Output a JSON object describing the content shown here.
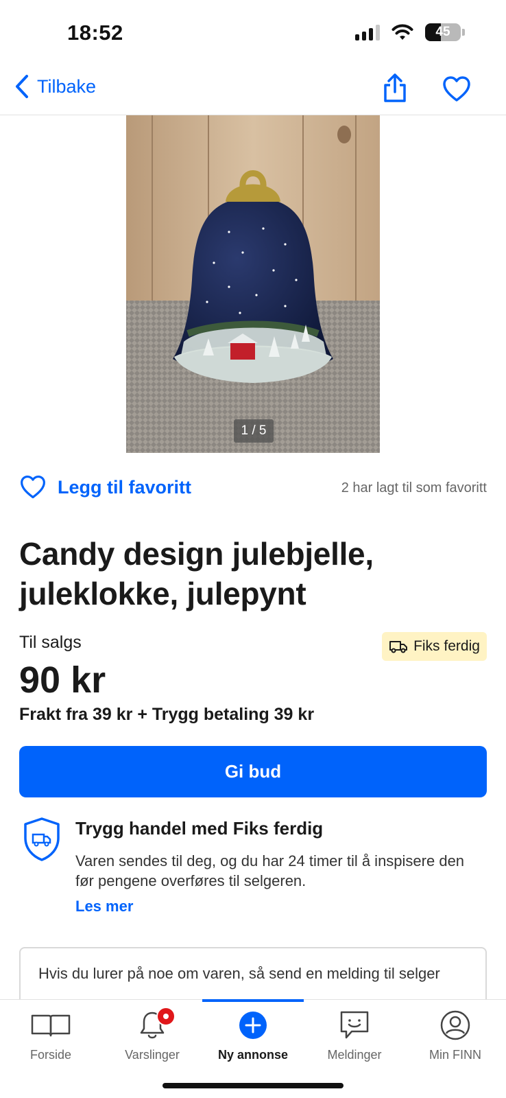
{
  "status_bar": {
    "time": "18:52",
    "battery": "45"
  },
  "nav": {
    "back_label": "Tilbake"
  },
  "gallery": {
    "counter": "1 / 5"
  },
  "favorite": {
    "add_label": "Legg til favoritt",
    "count_text": "2 har lagt til som favoritt"
  },
  "listing": {
    "title": "Candy design julebjelle, juleklokke, julepynt",
    "status": "Til salgs",
    "badge": "Fiks ferdig",
    "price": "90 kr",
    "shipping": "Frakt fra 39 kr + Trygg betaling 39 kr"
  },
  "actions": {
    "bid_label": "Gi bud"
  },
  "safe_trade": {
    "title": "Trygg handel med Fiks ferdig",
    "text": "Varen sendes til deg, og du har 24 timer til å inspisere den før pengene overføres til selgeren.",
    "link": "Les mer"
  },
  "message": {
    "prompt": "Hvis du lurer på noe om varen, så send en melding til selger"
  },
  "tabbar": {
    "items": [
      {
        "label": "Forside",
        "icon": "book-icon"
      },
      {
        "label": "Varslinger",
        "icon": "bell-icon"
      },
      {
        "label": "Ny annonse",
        "icon": "plus-circle-icon"
      },
      {
        "label": "Meldinger",
        "icon": "message-icon"
      },
      {
        "label": "Min FINN",
        "icon": "profile-icon"
      }
    ],
    "active": "Ny annonse"
  },
  "colors": {
    "accent": "#0063fb",
    "badge_bg": "#fff3c4",
    "notification": "#e0171a"
  }
}
